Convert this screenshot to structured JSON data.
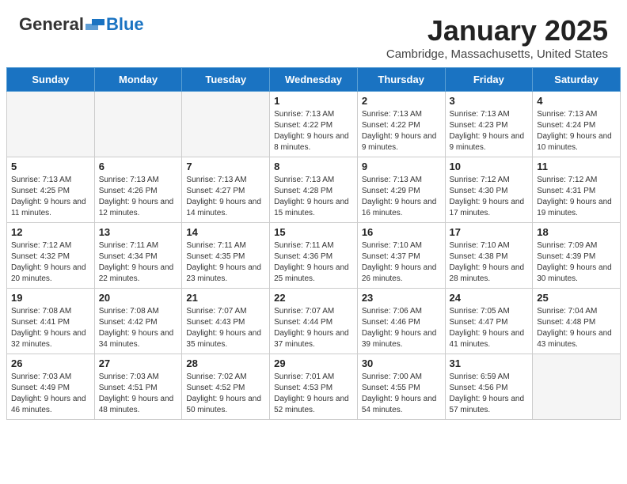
{
  "logo": {
    "general": "General",
    "blue": "Blue"
  },
  "header": {
    "title": "January 2025",
    "subtitle": "Cambridge, Massachusetts, United States"
  },
  "weekdays": [
    "Sunday",
    "Monday",
    "Tuesday",
    "Wednesday",
    "Thursday",
    "Friday",
    "Saturday"
  ],
  "weeks": [
    [
      {
        "day": "",
        "empty": true
      },
      {
        "day": "",
        "empty": true
      },
      {
        "day": "",
        "empty": true
      },
      {
        "day": "1",
        "sunrise": "7:13 AM",
        "sunset": "4:22 PM",
        "daylight": "9 hours and 8 minutes."
      },
      {
        "day": "2",
        "sunrise": "7:13 AM",
        "sunset": "4:22 PM",
        "daylight": "9 hours and 9 minutes."
      },
      {
        "day": "3",
        "sunrise": "7:13 AM",
        "sunset": "4:23 PM",
        "daylight": "9 hours and 9 minutes."
      },
      {
        "day": "4",
        "sunrise": "7:13 AM",
        "sunset": "4:24 PM",
        "daylight": "9 hours and 10 minutes."
      }
    ],
    [
      {
        "day": "5",
        "sunrise": "7:13 AM",
        "sunset": "4:25 PM",
        "daylight": "9 hours and 11 minutes."
      },
      {
        "day": "6",
        "sunrise": "7:13 AM",
        "sunset": "4:26 PM",
        "daylight": "9 hours and 12 minutes."
      },
      {
        "day": "7",
        "sunrise": "7:13 AM",
        "sunset": "4:27 PM",
        "daylight": "9 hours and 14 minutes."
      },
      {
        "day": "8",
        "sunrise": "7:13 AM",
        "sunset": "4:28 PM",
        "daylight": "9 hours and 15 minutes."
      },
      {
        "day": "9",
        "sunrise": "7:13 AM",
        "sunset": "4:29 PM",
        "daylight": "9 hours and 16 minutes."
      },
      {
        "day": "10",
        "sunrise": "7:12 AM",
        "sunset": "4:30 PM",
        "daylight": "9 hours and 17 minutes."
      },
      {
        "day": "11",
        "sunrise": "7:12 AM",
        "sunset": "4:31 PM",
        "daylight": "9 hours and 19 minutes."
      }
    ],
    [
      {
        "day": "12",
        "sunrise": "7:12 AM",
        "sunset": "4:32 PM",
        "daylight": "9 hours and 20 minutes."
      },
      {
        "day": "13",
        "sunrise": "7:11 AM",
        "sunset": "4:34 PM",
        "daylight": "9 hours and 22 minutes."
      },
      {
        "day": "14",
        "sunrise": "7:11 AM",
        "sunset": "4:35 PM",
        "daylight": "9 hours and 23 minutes."
      },
      {
        "day": "15",
        "sunrise": "7:11 AM",
        "sunset": "4:36 PM",
        "daylight": "9 hours and 25 minutes."
      },
      {
        "day": "16",
        "sunrise": "7:10 AM",
        "sunset": "4:37 PM",
        "daylight": "9 hours and 26 minutes."
      },
      {
        "day": "17",
        "sunrise": "7:10 AM",
        "sunset": "4:38 PM",
        "daylight": "9 hours and 28 minutes."
      },
      {
        "day": "18",
        "sunrise": "7:09 AM",
        "sunset": "4:39 PM",
        "daylight": "9 hours and 30 minutes."
      }
    ],
    [
      {
        "day": "19",
        "sunrise": "7:08 AM",
        "sunset": "4:41 PM",
        "daylight": "9 hours and 32 minutes."
      },
      {
        "day": "20",
        "sunrise": "7:08 AM",
        "sunset": "4:42 PM",
        "daylight": "9 hours and 34 minutes."
      },
      {
        "day": "21",
        "sunrise": "7:07 AM",
        "sunset": "4:43 PM",
        "daylight": "9 hours and 35 minutes."
      },
      {
        "day": "22",
        "sunrise": "7:07 AM",
        "sunset": "4:44 PM",
        "daylight": "9 hours and 37 minutes."
      },
      {
        "day": "23",
        "sunrise": "7:06 AM",
        "sunset": "4:46 PM",
        "daylight": "9 hours and 39 minutes."
      },
      {
        "day": "24",
        "sunrise": "7:05 AM",
        "sunset": "4:47 PM",
        "daylight": "9 hours and 41 minutes."
      },
      {
        "day": "25",
        "sunrise": "7:04 AM",
        "sunset": "4:48 PM",
        "daylight": "9 hours and 43 minutes."
      }
    ],
    [
      {
        "day": "26",
        "sunrise": "7:03 AM",
        "sunset": "4:49 PM",
        "daylight": "9 hours and 46 minutes."
      },
      {
        "day": "27",
        "sunrise": "7:03 AM",
        "sunset": "4:51 PM",
        "daylight": "9 hours and 48 minutes."
      },
      {
        "day": "28",
        "sunrise": "7:02 AM",
        "sunset": "4:52 PM",
        "daylight": "9 hours and 50 minutes."
      },
      {
        "day": "29",
        "sunrise": "7:01 AM",
        "sunset": "4:53 PM",
        "daylight": "9 hours and 52 minutes."
      },
      {
        "day": "30",
        "sunrise": "7:00 AM",
        "sunset": "4:55 PM",
        "daylight": "9 hours and 54 minutes."
      },
      {
        "day": "31",
        "sunrise": "6:59 AM",
        "sunset": "4:56 PM",
        "daylight": "9 hours and 57 minutes."
      },
      {
        "day": "",
        "empty": true
      }
    ]
  ]
}
